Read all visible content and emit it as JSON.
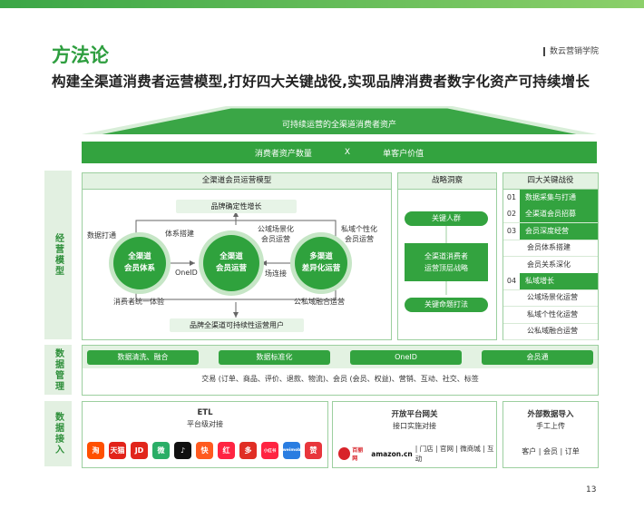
{
  "header": {
    "title": "方法论",
    "brand": "数云营销学院",
    "subtitle": "构建全渠道消费者运营模型,打好四大关键战役,实现品牌消费者数字化资产可持续增长"
  },
  "roof": {
    "label": "可持续运营的全渠道消费者资产"
  },
  "main_bar": {
    "left": "消费者资产数量",
    "op": "X",
    "right": "单客户价值"
  },
  "sections": {
    "ops": "经营模型",
    "data_mgmt": "数据管理",
    "data_access": "数据接入"
  },
  "model": {
    "header": "全渠道会员运营模型",
    "top_pill": "品牌确定性增长",
    "bottom_pill": "品牌全渠道可持续性运营用户",
    "circle1": "全渠道\n会员体系",
    "circle2": "全渠道\n会员运营",
    "circle3": "多渠道\n差异化运营",
    "labels": {
      "data_connect": "数据打通",
      "system_build": "体系搭建",
      "public_scene": "公域场景化\n会员运营",
      "private_personal": "私域个性化\n会员运营",
      "oneid": "OneID",
      "field_connect": "场连接",
      "unified_exp": "消费者统一体验",
      "private_fusion": "公私域融合运营"
    }
  },
  "strategy": {
    "header": "战略洞察",
    "btn1": "关键人群",
    "middle": "全渠道消费者\n运营顶层战略",
    "btn2": "关键命题打法"
  },
  "battles": {
    "header": "四大关键战役",
    "items": [
      {
        "num": "01",
        "label": "数据采集与打通",
        "hl": true
      },
      {
        "num": "02",
        "label": "全渠道会员招募",
        "hl": true
      },
      {
        "num": "03",
        "label": "会员深度经营",
        "hl": true
      },
      {
        "num": "",
        "label": "会员体系搭建",
        "hl": false
      },
      {
        "num": "",
        "label": "会员关系深化",
        "hl": false
      },
      {
        "num": "04",
        "label": "私域增长",
        "hl": true
      },
      {
        "num": "",
        "label": "公域场景化运营",
        "hl": false
      },
      {
        "num": "",
        "label": "私域个性化运营",
        "hl": false
      },
      {
        "num": "",
        "label": "公私域融合运营",
        "hl": false
      }
    ]
  },
  "data_mgmt": {
    "buttons": [
      "数据清洗、融合",
      "数据标准化",
      "OneID",
      "会员通"
    ],
    "trade_line": "交易 (订单、商品、评价、退款、物流)、会员 (会员、权益)、营销、互动、社交、标签"
  },
  "data_access": {
    "etl": {
      "title": "ETL",
      "sub": "平台级对接"
    },
    "platform": {
      "title": "开放平台网关",
      "sub": "接口实施对接",
      "logos_text": "百丽网",
      "amazon": "amazon.cn",
      "channels": "| 门店 | 官网 | 微商城 | 互动"
    },
    "external": {
      "title": "外部数据导入",
      "sub": "手工上传",
      "items": "客户 | 会员 | 订单"
    },
    "logos": [
      {
        "name": "taobao",
        "text": "淘",
        "color": "#ff5000"
      },
      {
        "name": "tmall",
        "text": "天猫",
        "color": "#e2231a"
      },
      {
        "name": "jd",
        "text": "JD",
        "color": "#e1251b"
      },
      {
        "name": "wechat",
        "text": "微",
        "color": "#2aae67"
      },
      {
        "name": "douyin",
        "text": "♪",
        "color": "#111111"
      },
      {
        "name": "kuaishou",
        "text": "快",
        "color": "#ff5a1f"
      },
      {
        "name": "xiaohongshu-red",
        "text": "红",
        "color": "#ff2442"
      },
      {
        "name": "pinduoduo",
        "text": "多",
        "color": "#e02e24"
      },
      {
        "name": "xiaohongshu",
        "text": "小红书",
        "color": "#ff2442"
      },
      {
        "name": "weimob",
        "text": "weimob",
        "color": "#2a7de1"
      },
      {
        "name": "thumb",
        "text": "赞",
        "color": "#e8363c"
      }
    ]
  },
  "page_number": "13",
  "colors": {
    "accent": "#33a33f",
    "light": "#e3f2e2"
  }
}
